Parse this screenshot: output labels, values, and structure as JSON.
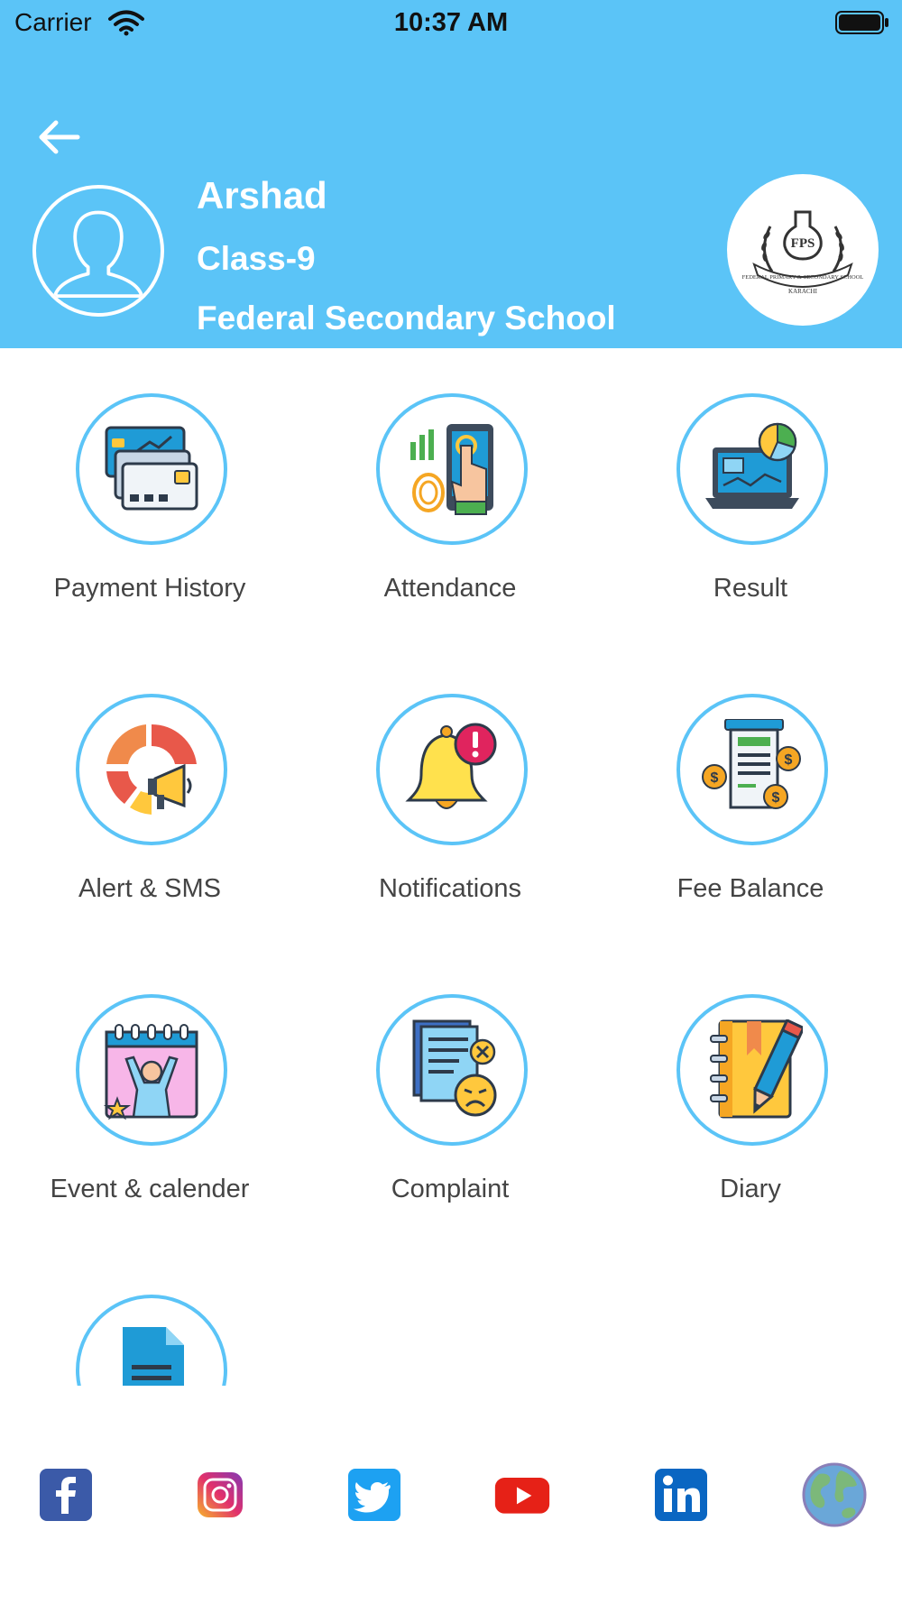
{
  "status_bar": {
    "carrier": "Carrier",
    "time": "10:37 AM"
  },
  "profile": {
    "name": "Arshad",
    "class": "Class-9",
    "school": "Federal Secondary School",
    "logo_text": "FPS",
    "logo_caption": "FEDERAL PRIMARY & SECONDARY SCHOOL",
    "logo_city": "KARACHI"
  },
  "menu": {
    "items": [
      {
        "label": "Payment History",
        "icon": "credit-cards-icon"
      },
      {
        "label": "Attendance",
        "icon": "fingerprint-scan-icon"
      },
      {
        "label": "Result",
        "icon": "laptop-chart-icon"
      },
      {
        "label": "Alert & SMS",
        "icon": "megaphone-alert-icon"
      },
      {
        "label": "Notifications",
        "icon": "bell-alert-icon"
      },
      {
        "label": "Fee Balance",
        "icon": "bill-coins-icon"
      },
      {
        "label": "Event & calender",
        "icon": "calendar-event-icon"
      },
      {
        "label": "Complaint",
        "icon": "complaint-document-icon"
      },
      {
        "label": "Diary",
        "icon": "notebook-pencil-icon"
      },
      {
        "label": "",
        "icon": "document-warning-icon"
      }
    ]
  },
  "social": {
    "links": [
      {
        "name": "facebook-icon"
      },
      {
        "name": "instagram-icon"
      },
      {
        "name": "twitter-icon"
      },
      {
        "name": "youtube-icon"
      },
      {
        "name": "linkedin-icon"
      },
      {
        "name": "globe-icon"
      }
    ]
  },
  "colors": {
    "header": "#5bc4f7",
    "circle_border": "#5bc4f7",
    "text": "#444444"
  }
}
